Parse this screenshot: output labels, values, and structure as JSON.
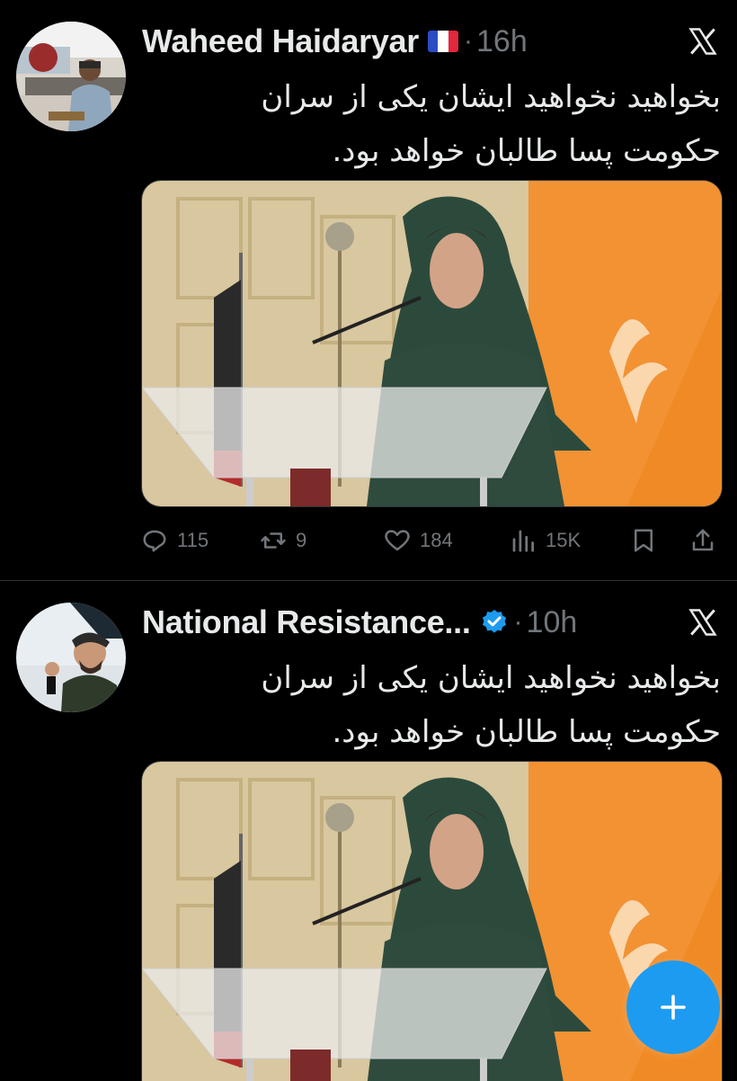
{
  "tweets": [
    {
      "author": "Waheed Haidaryar",
      "time": "16h",
      "lines": [
        "بخواهید نخواهید ایشان یکی از سران",
        "حکومت پسا طالبان خواهد بود."
      ],
      "actions": {
        "replies": "115",
        "reposts": "9",
        "likes": "184",
        "views": "15K"
      }
    },
    {
      "author": "National Resistance...",
      "time": "10h",
      "lines": [
        "بخواهید نخواهید ایشان یکی از سران",
        "حکومت پسا طالبان خواهد بود."
      ]
    }
  ],
  "dot": "·",
  "colors": {
    "background": "#000000",
    "accent": "#1d9bf0",
    "muted": "#71767b",
    "text": "#e7e9ea"
  },
  "icons": [
    "x-logo-icon",
    "verified-badge-icon",
    "reply-icon",
    "repost-icon",
    "like-icon",
    "views-icon",
    "bookmark-icon",
    "share-icon",
    "compose-plus-icon"
  ]
}
